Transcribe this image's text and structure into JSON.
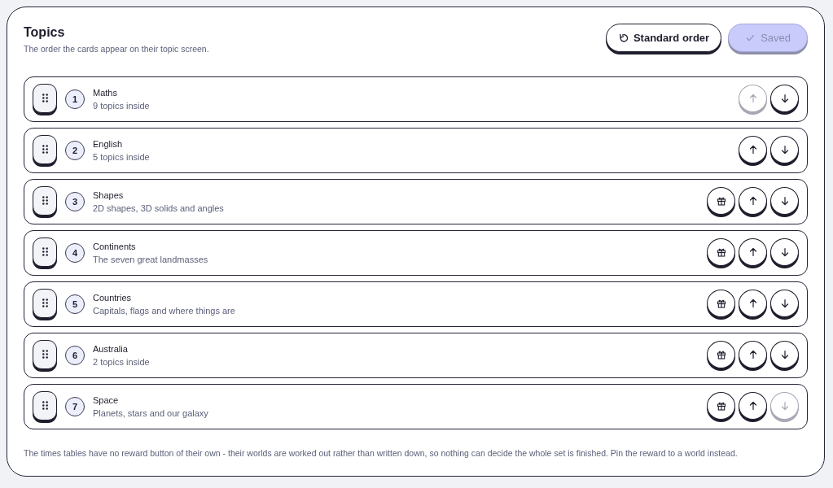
{
  "header": {
    "title": "Topics",
    "subtitle": "The order the cards appear on their topic screen."
  },
  "actions": [
    {
      "kind": "reset",
      "label": "Standard order",
      "disabled": false
    },
    {
      "kind": "check",
      "label": "Saved",
      "disabled": true
    }
  ],
  "topics": [
    {
      "number": "1",
      "name": "Maths",
      "detail": "9 topics inside",
      "reward": false,
      "up_disabled": true,
      "down_disabled": false
    },
    {
      "number": "2",
      "name": "English",
      "detail": "5 topics inside",
      "reward": false,
      "up_disabled": false,
      "down_disabled": false
    },
    {
      "number": "3",
      "name": "Shapes",
      "detail": "2D shapes, 3D solids and angles",
      "reward": true,
      "up_disabled": false,
      "down_disabled": false
    },
    {
      "number": "4",
      "name": "Continents",
      "detail": "The seven great landmasses",
      "reward": true,
      "up_disabled": false,
      "down_disabled": false
    },
    {
      "number": "5",
      "name": "Countries",
      "detail": "Capitals, flags and where things are",
      "reward": true,
      "up_disabled": false,
      "down_disabled": false
    },
    {
      "number": "6",
      "name": "Australia",
      "detail": "2 topics inside",
      "reward": true,
      "up_disabled": false,
      "down_disabled": false
    },
    {
      "number": "7",
      "name": "Space",
      "detail": "Planets, stars and our galaxy",
      "reward": true,
      "up_disabled": false,
      "down_disabled": true
    }
  ],
  "footnote": "The times tables have no reward button of their own - their worlds are worked out rather than written down, so nothing can decide the whole set is finished. Pin the reward to a world instead."
}
